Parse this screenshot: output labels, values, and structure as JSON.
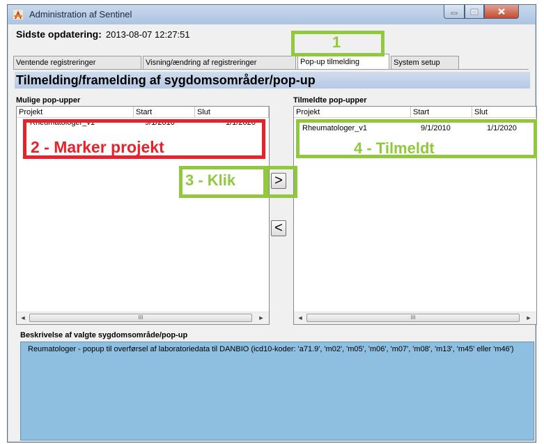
{
  "window": {
    "title": "Administration af Sentinel"
  },
  "update": {
    "label": "Sidste opdatering:",
    "value": "2013-08-07 12:27:51"
  },
  "tabs": [
    {
      "label": "Ventende registreringer"
    },
    {
      "label": "Visning/ændring af registreringer"
    },
    {
      "label": "Pop-up tilmelding"
    },
    {
      "label": "System setup"
    }
  ],
  "section": {
    "title": "Tilmelding/framelding af sygdomsområder/pop-up"
  },
  "left": {
    "label": "Mulige pop-upper",
    "headers": [
      "Projekt",
      "Start",
      "Slut"
    ],
    "rows": [
      {
        "project": "Rheumatologer_v1",
        "start": "9/1/2010",
        "end": "1/1/2020"
      }
    ]
  },
  "right": {
    "label": "Tilmeldte pop-upper",
    "headers": [
      "Projekt",
      "Start",
      "Slut"
    ],
    "rows": [
      {
        "project": "Rheumatologer_v1",
        "start": "9/1/2010",
        "end": "1/1/2020"
      }
    ]
  },
  "buttons": {
    "add": ">",
    "remove": "<"
  },
  "description": {
    "label": "Beskrivelse af valgte sygdomsområde/pop-up",
    "text": "Reumatologer - popup til overførsel af laboratoriedata til DANBIO (icd10-koder: 'a71.9', 'm02', 'm05', 'm06', 'm07', 'm08', 'm13', 'm45' eller 'm46')"
  },
  "annotations": {
    "step1": "1",
    "step2": "2 - Marker projekt",
    "step3": "3 - Klik",
    "step4": "4 - Tilmeldt",
    "green": "#92c83e",
    "red": "#e8222b"
  },
  "scroll_glyphs": {
    "left": "◄",
    "right": "►",
    "thumb": "III"
  }
}
